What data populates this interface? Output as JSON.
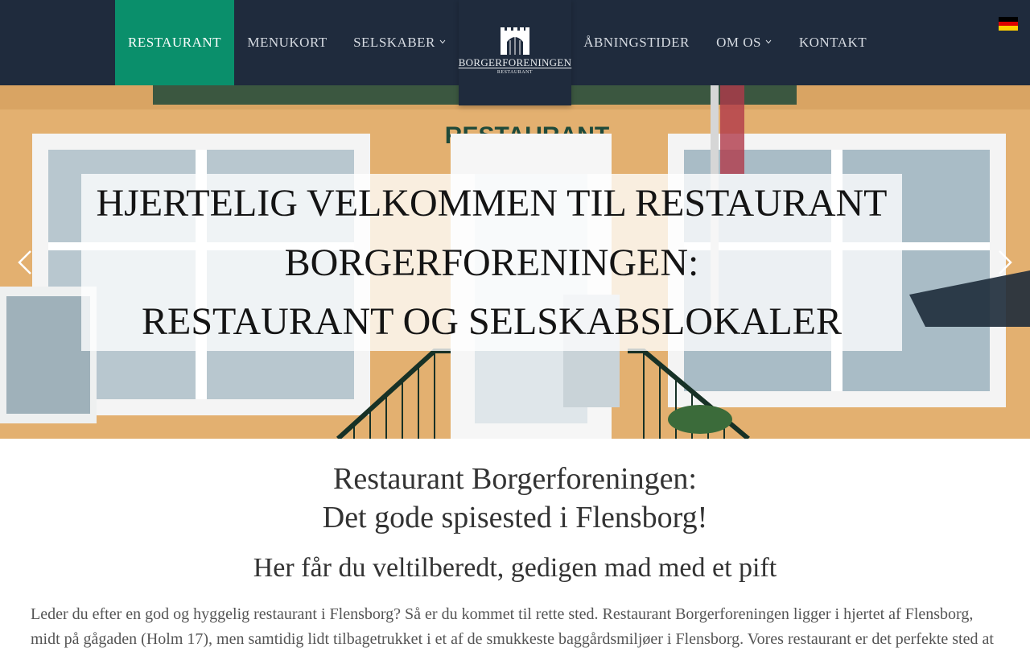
{
  "nav": {
    "items": [
      {
        "label": "RESTAURANT",
        "active": true,
        "has_dropdown": false
      },
      {
        "label": "MENUKORT",
        "active": false,
        "has_dropdown": false
      },
      {
        "label": "SELSKABER",
        "active": false,
        "has_dropdown": true
      },
      {
        "label": "ÅBNINGSTIDER",
        "active": false,
        "has_dropdown": false
      },
      {
        "label": "OM OS",
        "active": false,
        "has_dropdown": true
      },
      {
        "label": "KONTAKT",
        "active": false,
        "has_dropdown": false
      }
    ],
    "dropdown_icon": "chevron-down-icon",
    "logo": {
      "name": "BORGERFORENINGEN",
      "sub": "RESTAURANT",
      "icon": "building-gate-icon"
    },
    "language_flag": {
      "icon": "german-flag-icon",
      "colors": [
        "#000000",
        "#dd0000",
        "#ffce00"
      ]
    }
  },
  "hero": {
    "lines": [
      "HJERTELIG VELKOMMEN TIL RESTAURANT",
      "BORGERFORENINGEN:",
      "RESTAURANT OG SELSKABSLOKALER"
    ],
    "prev_icon": "chevron-left-icon",
    "next_icon": "chevron-right-icon",
    "sign_text": "RESTAURANT"
  },
  "content": {
    "heading_line1": "Restaurant Borgerforeningen:",
    "heading_line2": "Det gode spisested i Flensborg!",
    "subheading": "Her får du veltilberedt, gedigen mad med et pift",
    "body_line1": "Leder du efter en god og hyggelig restaurant i Flensborg? Så er du kommet til rette sted. Restaurant Borgerforeningen ligger i hjertet af Flensborg,",
    "body_line2": "midt på gågaden (Holm 17), men samtidig lidt tilbagetrukket i et af de smukkeste baggårdsmiljøer i Flensborg. Vores restaurant er det perfekte sted at"
  },
  "colors": {
    "nav_bg": "#1f2b3d",
    "nav_active": "#0a8f6b",
    "nav_text": "#d7dce3",
    "heading": "#333333",
    "body": "#555555"
  }
}
